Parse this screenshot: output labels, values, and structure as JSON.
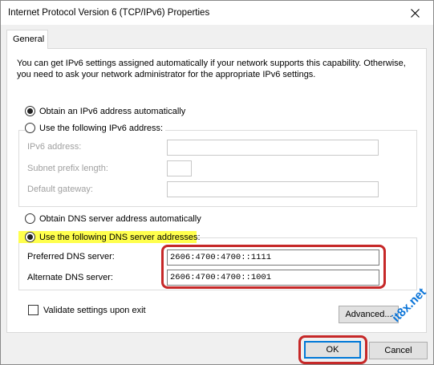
{
  "window": {
    "title": "Internet Protocol Version 6 (TCP/IPv6) Properties",
    "close_icon": "close-icon"
  },
  "tabs": [
    {
      "label": "General",
      "selected": true
    }
  ],
  "description": "You can get IPv6 settings assigned automatically if your network supports this capability. Otherwise, you need to ask your network administrator for the appropriate IPv6 settings.",
  "ip_section": {
    "obtain_auto": {
      "label": "Obtain an IPv6 address automatically",
      "selected": true
    },
    "use_following": {
      "label": "Use the following IPv6 address:",
      "selected": false
    },
    "fields": [
      {
        "label": "IPv6 address:",
        "value": "",
        "enabled": false
      },
      {
        "label": "Subnet prefix length:",
        "value": "",
        "enabled": false
      },
      {
        "label": "Default gateway:",
        "value": "",
        "enabled": false
      }
    ]
  },
  "dns_section": {
    "obtain_auto": {
      "label": "Obtain DNS server address automatically",
      "selected": false
    },
    "use_following": {
      "label": "Use the following DNS server addresses:",
      "selected": true
    },
    "preferred": {
      "label": "Preferred DNS server:",
      "value": "2606:4700:4700::1111"
    },
    "alternate": {
      "label": "Alternate DNS server:",
      "value": "2606:4700:4700::1001"
    }
  },
  "validate": {
    "label": "Validate settings upon exit",
    "checked": false
  },
  "buttons": {
    "advanced": "Advanced...",
    "ok": "OK",
    "cancel": "Cancel"
  },
  "watermark": "it8x.net",
  "colors": {
    "highlight": "#ffff4d",
    "annotation_ring": "#c62828",
    "focus": "#0078d7",
    "watermark": "#0a74d8"
  }
}
